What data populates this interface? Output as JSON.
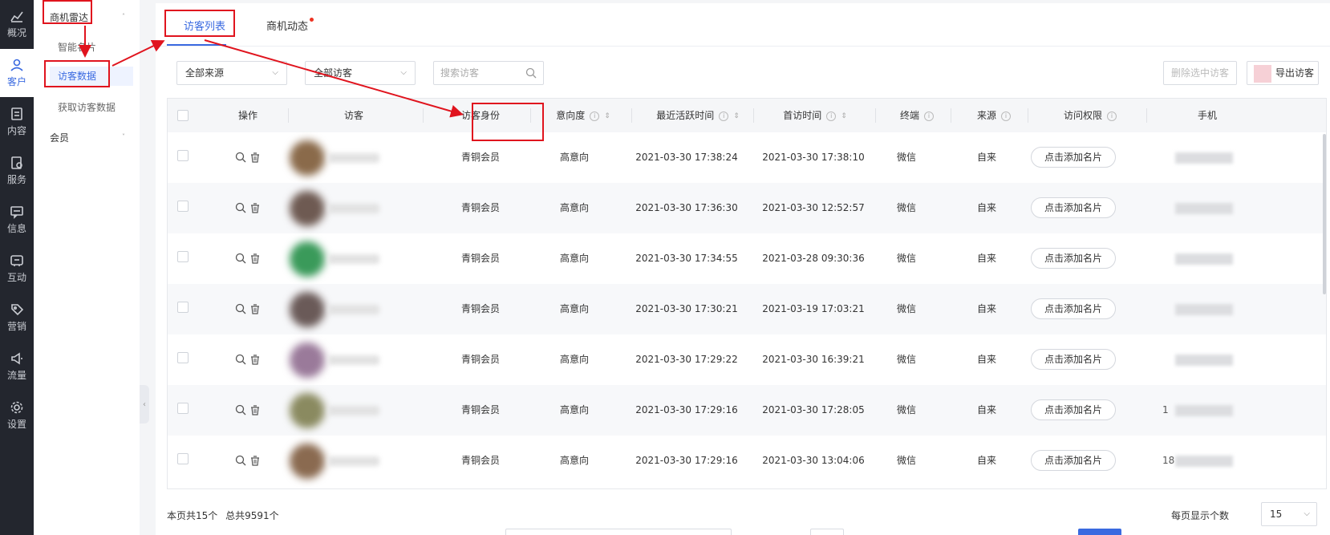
{
  "rail": {
    "items": [
      {
        "label": "概况",
        "icon": "chart-icon"
      },
      {
        "label": "客户",
        "icon": "user-icon"
      },
      {
        "label": "内容",
        "icon": "document-icon"
      },
      {
        "label": "服务",
        "icon": "service-icon"
      },
      {
        "label": "信息",
        "icon": "message-icon"
      },
      {
        "label": "互动",
        "icon": "interaction-icon"
      },
      {
        "label": "营销",
        "icon": "tag-icon"
      },
      {
        "label": "流量",
        "icon": "megaphone-icon"
      },
      {
        "label": "设置",
        "icon": "gear-icon"
      }
    ]
  },
  "submenu": {
    "group1": "商机雷达",
    "items": [
      "智能名片",
      "访客数据",
      "获取访客数据"
    ],
    "group2": "会员"
  },
  "tabs": {
    "list": "访客列表",
    "activity": "商机动态"
  },
  "filters": {
    "source": "全部来源",
    "visitor_type": "全部访客",
    "search_placeholder": "搜索访客",
    "delete_label": "删除选中访客",
    "export_label": "导出访客"
  },
  "table": {
    "headers": [
      "操作",
      "访客",
      "访客身份",
      "意向度",
      "最近活跃时间",
      "首访时间",
      "终端",
      "来源",
      "访问权限",
      "手机"
    ],
    "rows": [
      {
        "identity": "青铜会员",
        "intent": "高意向",
        "last_active": "2021-03-30 17:38:24",
        "first_visit": "2021-03-30 17:38:10",
        "terminal": "微信",
        "source": "自来",
        "permission": "点击添加名片",
        "phone": ""
      },
      {
        "identity": "青铜会员",
        "intent": "高意向",
        "last_active": "2021-03-30 17:36:30",
        "first_visit": "2021-03-30 12:52:57",
        "terminal": "微信",
        "source": "自来",
        "permission": "点击添加名片",
        "phone": ""
      },
      {
        "identity": "青铜会员",
        "intent": "高意向",
        "last_active": "2021-03-30 17:34:55",
        "first_visit": "2021-03-28 09:30:36",
        "terminal": "微信",
        "source": "自来",
        "permission": "点击添加名片",
        "phone": ""
      },
      {
        "identity": "青铜会员",
        "intent": "高意向",
        "last_active": "2021-03-30 17:30:21",
        "first_visit": "2021-03-19 17:03:21",
        "terminal": "微信",
        "source": "自来",
        "permission": "点击添加名片",
        "phone": ""
      },
      {
        "identity": "青铜会员",
        "intent": "高意向",
        "last_active": "2021-03-30 17:29:22",
        "first_visit": "2021-03-30 16:39:21",
        "terminal": "微信",
        "source": "自来",
        "permission": "点击添加名片",
        "phone": ""
      },
      {
        "identity": "青铜会员",
        "intent": "高意向",
        "last_active": "2021-03-30 17:29:16",
        "first_visit": "2021-03-30 17:28:05",
        "terminal": "微信",
        "source": "自来",
        "permission": "点击添加名片",
        "phone": "1"
      },
      {
        "identity": "青铜会员",
        "intent": "高意向",
        "last_active": "2021-03-30 17:29:16",
        "first_visit": "2021-03-30 13:04:06",
        "terminal": "微信",
        "source": "自来",
        "permission": "点击添加名片",
        "phone": "18"
      }
    ]
  },
  "footer": {
    "page_count": "本页共15个",
    "total": "总共9591个",
    "per_page_label": "每页显示个数",
    "per_page_value": "15"
  },
  "colors": {
    "accent": "#3a6ae0",
    "annotation": "#e0141e",
    "rail_bg": "#23262e"
  }
}
